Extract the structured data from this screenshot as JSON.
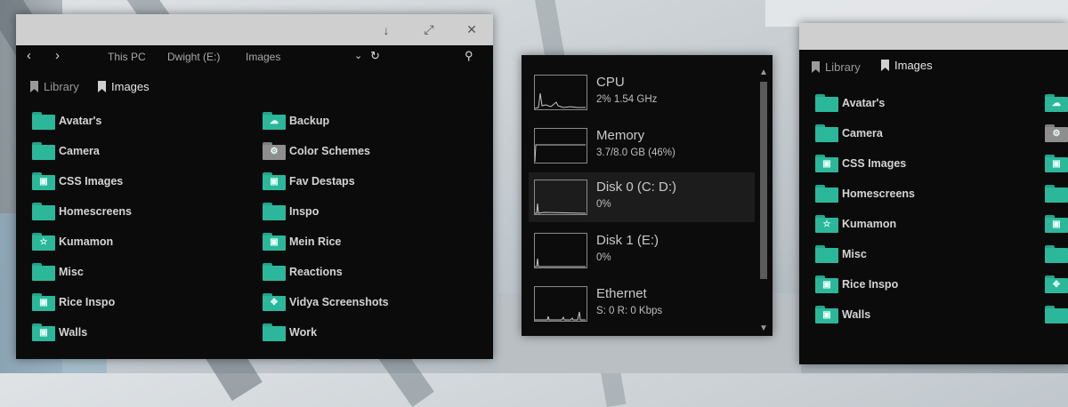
{
  "explorer": {
    "breadcrumb": [
      "This PC",
      "Dwight (E:)",
      "Images"
    ],
    "tabs": [
      "Library",
      "Images"
    ],
    "left_items": [
      {
        "name": "Avatar's",
        "icon": "folder-icon"
      },
      {
        "name": "Camera",
        "icon": "folder-icon"
      },
      {
        "name": "CSS Images",
        "icon": "folder-image-icon"
      },
      {
        "name": "Homescreens",
        "icon": "folder-icon"
      },
      {
        "name": "Kumamon",
        "icon": "folder-star-icon"
      },
      {
        "name": "Misc",
        "icon": "folder-icon"
      },
      {
        "name": "Rice Inspo",
        "icon": "folder-image-icon"
      },
      {
        "name": "Walls",
        "icon": "folder-image-icon"
      }
    ],
    "right_items": [
      {
        "name": "Backup",
        "icon": "folder-cloud-icon"
      },
      {
        "name": "Color Schemes",
        "icon": "folder-gear-icon"
      },
      {
        "name": "Fav Destaps",
        "icon": "folder-image-icon"
      },
      {
        "name": "Inspo",
        "icon": "folder-icon"
      },
      {
        "name": "Mein Rice",
        "icon": "folder-image-icon"
      },
      {
        "name": "Reactions",
        "icon": "folder-icon"
      },
      {
        "name": "Vidya Screenshots",
        "icon": "folder-gamepad-icon"
      },
      {
        "name": "Work",
        "icon": "folder-icon"
      }
    ]
  },
  "task_manager": {
    "items": [
      {
        "title": "CPU",
        "sub": "2%  1.54 GHz"
      },
      {
        "title": "Memory",
        "sub": "3.7/8.0 GB (46%)"
      },
      {
        "title": "Disk 0 (C: D:)",
        "sub": "0%"
      },
      {
        "title": "Disk 1 (E:)",
        "sub": "0%"
      },
      {
        "title": "Ethernet",
        "sub": "S: 0 R: 0 Kbps"
      }
    ]
  },
  "explorer2": {
    "tabs": [
      "Library",
      "Images"
    ],
    "items": [
      "Avatar's",
      "Camera",
      "CSS Images",
      "Homescreens",
      "Kumamon",
      "Misc",
      "Rice Inspo",
      "Walls"
    ]
  },
  "colors": {
    "accent": "#2bb89a",
    "window_bg": "#0b0b0b",
    "titlebar": "#cfcfcf"
  }
}
